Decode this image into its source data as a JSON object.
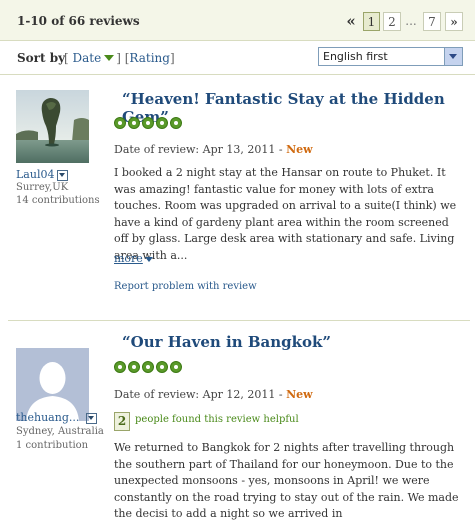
{
  "header": {
    "review_count": "1-10 of 66 reviews",
    "pager": {
      "prev": "«",
      "pages": [
        "1",
        "2",
        "...",
        "7"
      ],
      "next": "»",
      "current": "1"
    }
  },
  "sort": {
    "label": "Sort by",
    "option_date": "Date",
    "option_rating": "Rating",
    "language_select": "English first"
  },
  "reviews": [
    {
      "username": "Laul04",
      "location": "Surrey,UK",
      "contributions": "14 contributions",
      "title": "“Heaven! Fantastic Stay at the Hidden Gem”",
      "rating": 5,
      "date_label": "Date of review: Apr 13, 2011 - ",
      "new_badge": "New",
      "body": "I booked a 2 night stay at the Hansar on route to Phuket. It was amazing! fantastic value for money with lots of extra touches. Room was upgraded on arrival to a suite(I think) we have a kind of gardeny plant area within the room screened off by glass. Large desk area with stationary and safe. Living area with a...",
      "more": "more",
      "report": "Report problem with review"
    },
    {
      "username": "thehuang...",
      "location": "Sydney, Australia",
      "contributions": "1 contribution",
      "title": "“Our Haven in Bangkok”",
      "rating": 5,
      "date_label": "Date of review: Apr 12, 2011 - ",
      "new_badge": "New",
      "helpful_count": "2",
      "helpful_text": "people found this review helpful",
      "body": "We returned to Bangkok for 2 nights after travelling through the southern part of Thailand for our honeymoon. Due to the unexpected monsoons - yes, monsoons in April! we were constantly on the road trying to stay out of the rain. We made the decisi to add a night so we arrived in"
    }
  ],
  "colors": {
    "link": "#2a5a8c",
    "title": "#1f4a7a",
    "bubble": "#5a9a2a",
    "new": "#d06a10",
    "header_bg": "#f4f6e8"
  }
}
